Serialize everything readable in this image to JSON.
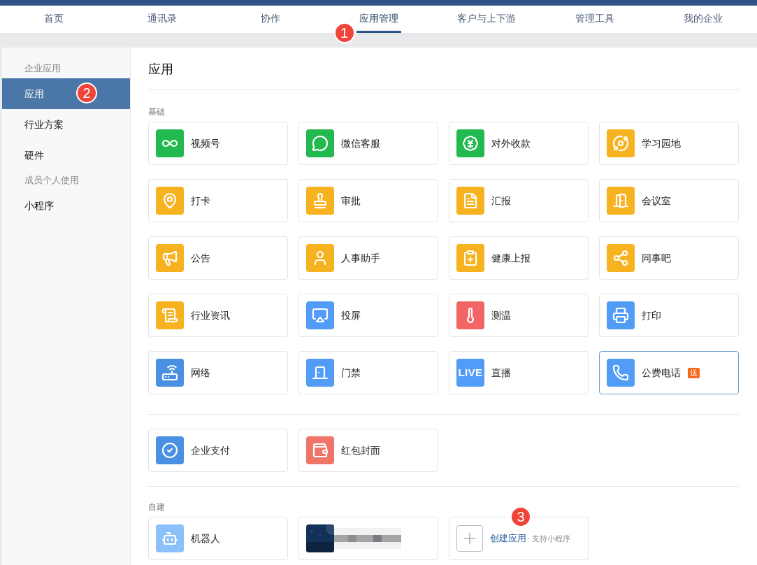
{
  "nav": {
    "tabs": [
      {
        "label": "首页",
        "selected": false
      },
      {
        "label": "通讯录",
        "selected": false
      },
      {
        "label": "协作",
        "selected": false
      },
      {
        "label": "应用管理",
        "selected": true,
        "marker": "1"
      },
      {
        "label": "客户与上下游",
        "selected": false
      },
      {
        "label": "管理工具",
        "selected": false
      },
      {
        "label": "我的企业",
        "selected": false
      }
    ]
  },
  "sidebar": {
    "groups": [
      {
        "header": "企业应用",
        "items": [
          {
            "label": "应用",
            "selected": true,
            "marker": "2"
          },
          {
            "label": "行业方案",
            "selected": false
          },
          {
            "label": "硬件",
            "selected": false
          }
        ]
      },
      {
        "header": "成员个人使用",
        "items": [
          {
            "label": "小程序",
            "selected": false
          }
        ]
      }
    ]
  },
  "main": {
    "title": "应用",
    "basic": {
      "header": "基础",
      "apps": [
        {
          "name": "视频号",
          "color": "#22b94f",
          "selected": false
        },
        {
          "name": "微信客服",
          "color": "#22b94f",
          "selected": false
        },
        {
          "name": "对外收款",
          "color": "#22b94f",
          "selected": false
        },
        {
          "name": "学习园地",
          "color": "#f6b21f",
          "selected": false
        },
        {
          "name": "打卡",
          "color": "#f6b21f",
          "selected": false
        },
        {
          "name": "审批",
          "color": "#f6b21f",
          "selected": false
        },
        {
          "name": "汇报",
          "color": "#f6b21f",
          "selected": false
        },
        {
          "name": "会议室",
          "color": "#f6b21f",
          "selected": false
        },
        {
          "name": "公告",
          "color": "#f6b21f",
          "selected": false
        },
        {
          "name": "人事助手",
          "color": "#f6b21f",
          "selected": false
        },
        {
          "name": "健康上报",
          "color": "#f6b21f",
          "selected": false
        },
        {
          "name": "同事吧",
          "color": "#f6b21f",
          "selected": false
        },
        {
          "name": "行业资讯",
          "color": "#f6b21f",
          "selected": false
        },
        {
          "name": "投屏",
          "color": "#519cf6",
          "selected": false
        },
        {
          "name": "测温",
          "color": "#f26666",
          "selected": false
        },
        {
          "name": "打印",
          "color": "#519cf6",
          "selected": false
        },
        {
          "name": "网络",
          "color": "#4a90e2",
          "selected": false
        },
        {
          "name": "门禁",
          "color": "#519cf6",
          "selected": false
        },
        {
          "name": "直播",
          "color": "#519cf6",
          "icon_label": "LIVE",
          "selected": false
        },
        {
          "name": "公费电话",
          "color": "#519cf6",
          "badge": "送",
          "selected": true
        }
      ]
    },
    "extra": {
      "apps": [
        {
          "name": "企业支付",
          "color": "#4a90e2",
          "selected": false
        },
        {
          "name": "红包封面",
          "color": "#ef7569",
          "selected": false
        }
      ]
    },
    "custom": {
      "header": "自建",
      "apps": [
        {
          "kind": "app",
          "name": "机器人",
          "color": "#8cc0fb"
        },
        {
          "kind": "blurred"
        }
      ],
      "create": {
        "label": "创建应用",
        "hint": "· 支持小程序",
        "marker": "3"
      }
    }
  }
}
